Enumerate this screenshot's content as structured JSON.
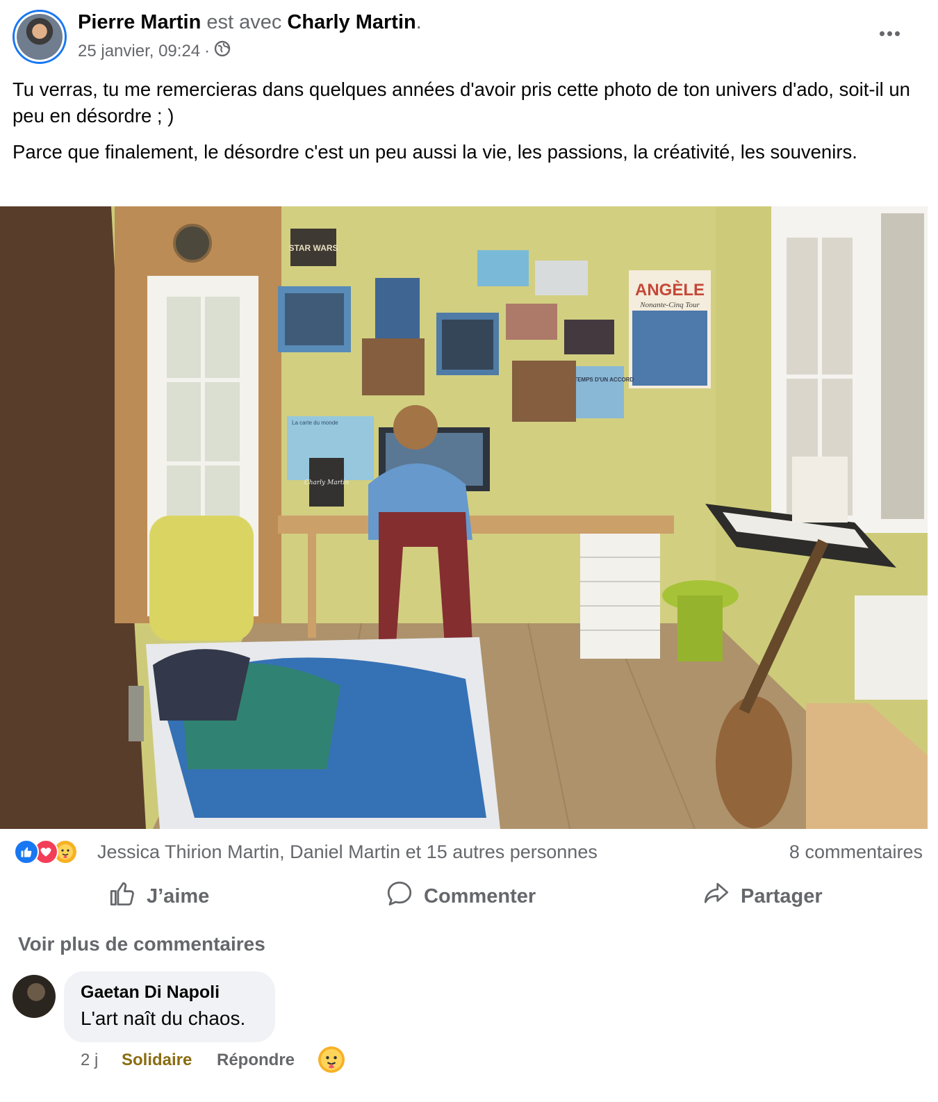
{
  "post": {
    "author": "Pierre Martin",
    "with_text": "est avec",
    "tagged": "Charly Martin",
    "period": ".",
    "date": "25 janvier, 09:24",
    "separator": "·",
    "paragraphs": [
      "Tu verras, tu me remercieras dans quelques années d'avoir pris cette photo de ton univers d'ado, soit-il un peu en désordre ; )",
      "Parce que finalement, le désordre c'est un peu aussi la vie, les passions, la créativité, les souvenirs."
    ]
  },
  "photo": {
    "poster_starwars": "STAR WARS",
    "poster_angele_title": "ANGÈLE",
    "poster_angele_sub": "Nonante-Cinq Tour",
    "poster_temps": "LE TEMPS D'UN ACCORD",
    "map_title": "La carte du monde",
    "note": "Charly Martin"
  },
  "reactions": {
    "icons": [
      "like-icon",
      "love-icon",
      "care-icon"
    ],
    "names": "Jessica Thirion Martin, Daniel Martin et 15 autres personnes",
    "comments": "8 commentaires"
  },
  "actions": {
    "like": "J’aime",
    "comment": "Commenter",
    "share": "Partager"
  },
  "comments_section": {
    "view_more": "Voir plus de commentaires",
    "items": [
      {
        "author": "Gaetan Di Napoli",
        "text": "L'art naît du chaos.",
        "time": "2 j",
        "reaction_label": "Solidaire",
        "reply_label": "Répondre",
        "reaction_icon": "care-icon"
      }
    ]
  },
  "colors": {
    "accent": "#1877f2",
    "muted_text": "#65676b",
    "text": "#050505",
    "bubble": "#f0f2f5",
    "solidaire": "#8a6d12"
  }
}
